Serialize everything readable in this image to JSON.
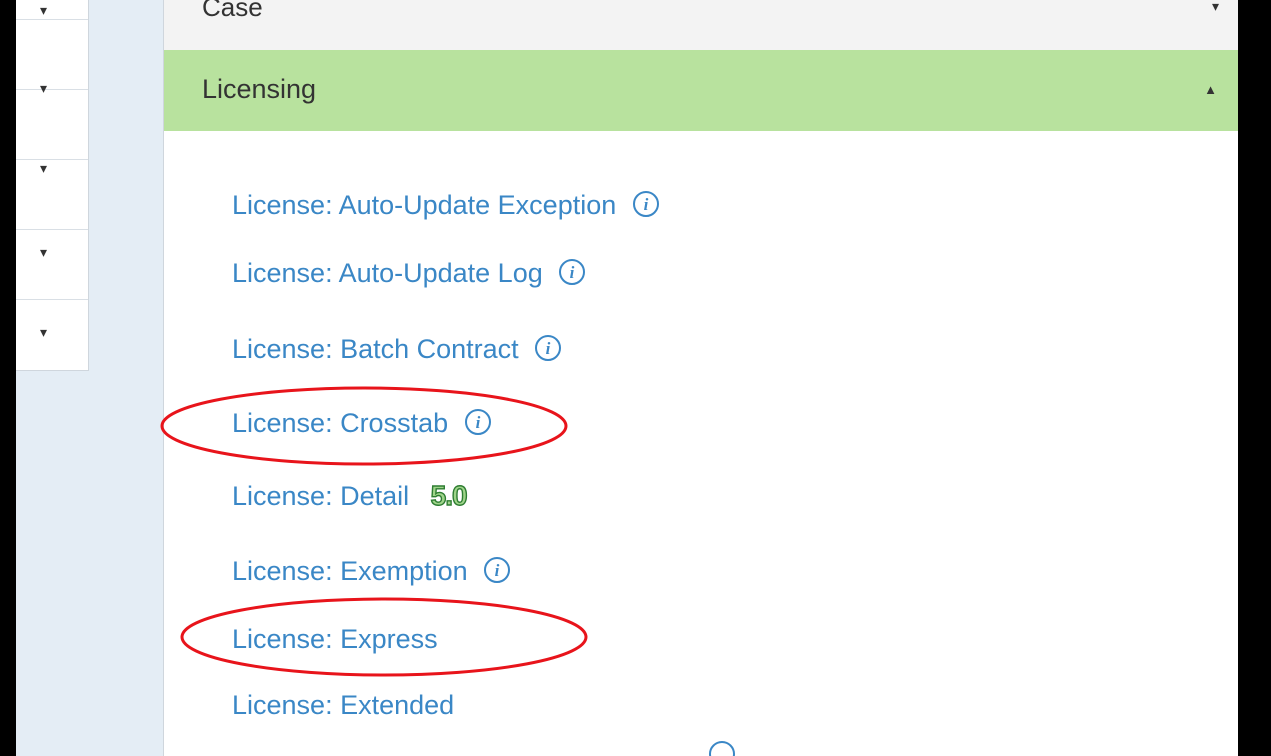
{
  "sidebar": {
    "arrows": [
      "▾",
      "▾",
      "▾",
      "▾",
      "▾"
    ]
  },
  "accordion": {
    "case": {
      "label": "Case",
      "arrow": "▾"
    },
    "licensing": {
      "label": "Licensing",
      "arrow": "▲"
    }
  },
  "reports": [
    {
      "label": "License: Auto-Update Exception",
      "icon": "info-icon"
    },
    {
      "label": "License: Auto-Update Log",
      "icon": "info-icon"
    },
    {
      "label": "License: Batch Contract",
      "icon": "info-icon"
    },
    {
      "label": "License: Crosstab",
      "icon": "info-icon"
    },
    {
      "label": "License: Detail",
      "badge": "5.0"
    },
    {
      "label": "License: Exemption",
      "icon": "info-icon"
    },
    {
      "label": "License: Express"
    },
    {
      "label": "License: Extended"
    }
  ],
  "colors": {
    "link": "#3a87c6",
    "active_header": "#b8e29e",
    "highlight_circle": "#e8141b"
  }
}
